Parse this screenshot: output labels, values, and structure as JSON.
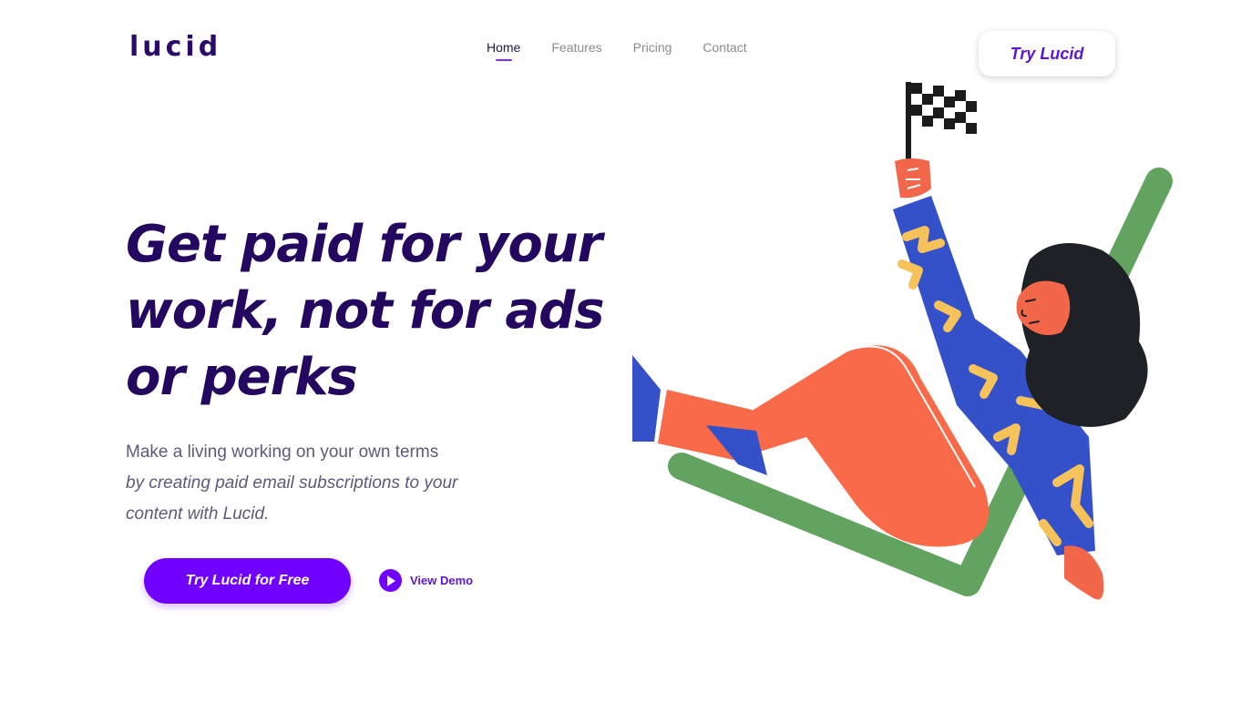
{
  "brand": {
    "logo": "lucid"
  },
  "nav": {
    "items": [
      {
        "label": "Home",
        "active": true
      },
      {
        "label": "Features",
        "active": false
      },
      {
        "label": "Pricing",
        "active": false
      },
      {
        "label": "Contact",
        "active": false
      }
    ]
  },
  "header": {
    "try_button": "Try Lucid"
  },
  "hero": {
    "title_lines": [
      "Get paid for your",
      "work, not for ads",
      "or perks"
    ],
    "subtitle_lines": [
      "Make a living working on your own terms",
      "by creating paid  email subscriptions to your",
      "content with Lucid."
    ],
    "cta_label": "Try Lucid for Free",
    "demo_label": "View Demo"
  },
  "colors": {
    "brand_dark": "#24085f",
    "accent": "#7000ff",
    "text_muted": "#5e5a78"
  },
  "icons": [
    "play-icon",
    "woman-with-flag-illustration"
  ]
}
